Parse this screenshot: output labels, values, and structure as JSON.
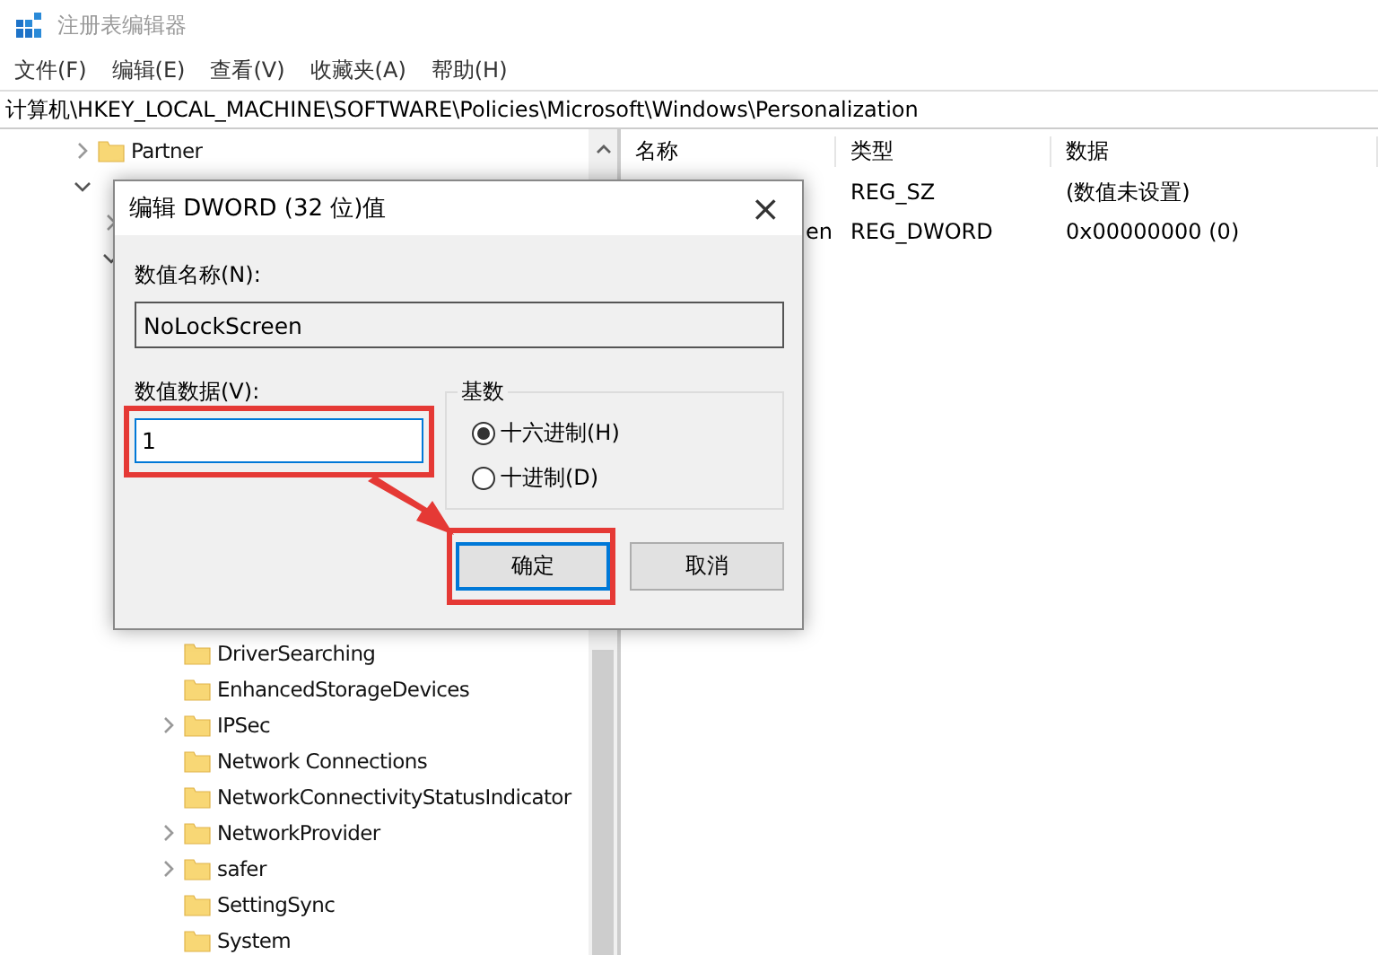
{
  "window": {
    "title": "注册表编辑器"
  },
  "menu": [
    "文件(F)",
    "编辑(E)",
    "查看(V)",
    "收藏夹(A)",
    "帮助(H)"
  ],
  "address": "计算机\\HKEY_LOCAL_MACHINE\\SOFTWARE\\Policies\\Microsoft\\Windows\\Personalization",
  "tree": [
    {
      "label": "Partner",
      "expanded": false,
      "has_children": true
    },
    {
      "expanded": true,
      "has_children": true,
      "children": [
        {
          "expanded": false,
          "has_children": true
        },
        {
          "expanded": true,
          "has_children": true,
          "children": [
            {
              "label": "DriverSearching",
              "has_children": false
            },
            {
              "label": "EnhancedStorageDevices",
              "has_children": false
            },
            {
              "label": "IPSec",
              "expanded": false,
              "has_children": true
            },
            {
              "label": "Network Connections",
              "has_children": false
            },
            {
              "label": "NetworkConnectivityStatusIndicator",
              "has_children": false
            },
            {
              "label": "NetworkProvider",
              "expanded": false,
              "has_children": true
            },
            {
              "label": "safer",
              "expanded": false,
              "has_children": true
            },
            {
              "label": "SettingSync",
              "has_children": false
            },
            {
              "label": "System",
              "has_children": false
            }
          ]
        }
      ]
    }
  ],
  "table": {
    "columns": [
      "名称",
      "类型",
      "数据"
    ],
    "rows": [
      {
        "type": "REG_SZ",
        "data": "(数值未设置)"
      },
      {
        "name": "en",
        "type": "REG_DWORD",
        "data": "0x00000000 (0)"
      }
    ]
  },
  "dialog": {
    "title": "编辑 DWORD (32 位)值",
    "close": "×",
    "name_label": "数值名称(N):",
    "name_value": "NoLockScreen",
    "data_label": "数值数据(V):",
    "data_value": "1",
    "base_label": "基数",
    "radios": [
      {
        "label": "十六进制(H)",
        "selected": true
      },
      {
        "label": "十进制(D)",
        "selected": false
      }
    ],
    "buttons": [
      {
        "label": "确定",
        "default": true,
        "highlighted": true
      },
      {
        "label": "取消",
        "default": false,
        "highlighted": false
      }
    ],
    "data_highlighted": true
  }
}
